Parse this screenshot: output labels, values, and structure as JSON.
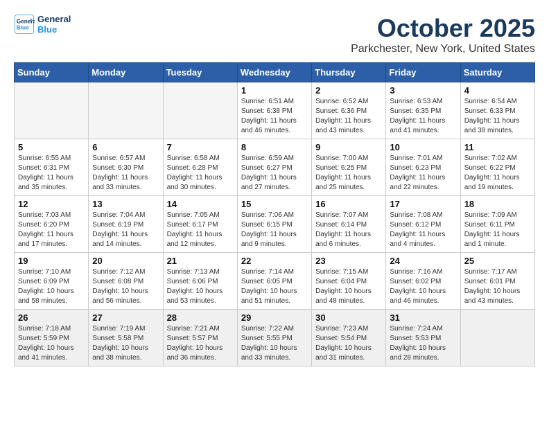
{
  "header": {
    "logo_line1": "General",
    "logo_line2": "Blue",
    "month": "October 2025",
    "location": "Parkchester, New York, United States"
  },
  "days_of_week": [
    "Sunday",
    "Monday",
    "Tuesday",
    "Wednesday",
    "Thursday",
    "Friday",
    "Saturday"
  ],
  "weeks": [
    [
      {
        "day": "",
        "info": ""
      },
      {
        "day": "",
        "info": ""
      },
      {
        "day": "",
        "info": ""
      },
      {
        "day": "1",
        "info": "Sunrise: 6:51 AM\nSunset: 6:38 PM\nDaylight: 11 hours\nand 46 minutes."
      },
      {
        "day": "2",
        "info": "Sunrise: 6:52 AM\nSunset: 6:36 PM\nDaylight: 11 hours\nand 43 minutes."
      },
      {
        "day": "3",
        "info": "Sunrise: 6:53 AM\nSunset: 6:35 PM\nDaylight: 11 hours\nand 41 minutes."
      },
      {
        "day": "4",
        "info": "Sunrise: 6:54 AM\nSunset: 6:33 PM\nDaylight: 11 hours\nand 38 minutes."
      }
    ],
    [
      {
        "day": "5",
        "info": "Sunrise: 6:55 AM\nSunset: 6:31 PM\nDaylight: 11 hours\nand 35 minutes."
      },
      {
        "day": "6",
        "info": "Sunrise: 6:57 AM\nSunset: 6:30 PM\nDaylight: 11 hours\nand 33 minutes."
      },
      {
        "day": "7",
        "info": "Sunrise: 6:58 AM\nSunset: 6:28 PM\nDaylight: 11 hours\nand 30 minutes."
      },
      {
        "day": "8",
        "info": "Sunrise: 6:59 AM\nSunset: 6:27 PM\nDaylight: 11 hours\nand 27 minutes."
      },
      {
        "day": "9",
        "info": "Sunrise: 7:00 AM\nSunset: 6:25 PM\nDaylight: 11 hours\nand 25 minutes."
      },
      {
        "day": "10",
        "info": "Sunrise: 7:01 AM\nSunset: 6:23 PM\nDaylight: 11 hours\nand 22 minutes."
      },
      {
        "day": "11",
        "info": "Sunrise: 7:02 AM\nSunset: 6:22 PM\nDaylight: 11 hours\nand 19 minutes."
      }
    ],
    [
      {
        "day": "12",
        "info": "Sunrise: 7:03 AM\nSunset: 6:20 PM\nDaylight: 11 hours\nand 17 minutes."
      },
      {
        "day": "13",
        "info": "Sunrise: 7:04 AM\nSunset: 6:19 PM\nDaylight: 11 hours\nand 14 minutes."
      },
      {
        "day": "14",
        "info": "Sunrise: 7:05 AM\nSunset: 6:17 PM\nDaylight: 11 hours\nand 12 minutes."
      },
      {
        "day": "15",
        "info": "Sunrise: 7:06 AM\nSunset: 6:15 PM\nDaylight: 11 hours\nand 9 minutes."
      },
      {
        "day": "16",
        "info": "Sunrise: 7:07 AM\nSunset: 6:14 PM\nDaylight: 11 hours\nand 6 minutes."
      },
      {
        "day": "17",
        "info": "Sunrise: 7:08 AM\nSunset: 6:12 PM\nDaylight: 11 hours\nand 4 minutes."
      },
      {
        "day": "18",
        "info": "Sunrise: 7:09 AM\nSunset: 6:11 PM\nDaylight: 11 hours\nand 1 minute."
      }
    ],
    [
      {
        "day": "19",
        "info": "Sunrise: 7:10 AM\nSunset: 6:09 PM\nDaylight: 10 hours\nand 58 minutes."
      },
      {
        "day": "20",
        "info": "Sunrise: 7:12 AM\nSunset: 6:08 PM\nDaylight: 10 hours\nand 56 minutes."
      },
      {
        "day": "21",
        "info": "Sunrise: 7:13 AM\nSunset: 6:06 PM\nDaylight: 10 hours\nand 53 minutes."
      },
      {
        "day": "22",
        "info": "Sunrise: 7:14 AM\nSunset: 6:05 PM\nDaylight: 10 hours\nand 51 minutes."
      },
      {
        "day": "23",
        "info": "Sunrise: 7:15 AM\nSunset: 6:04 PM\nDaylight: 10 hours\nand 48 minutes."
      },
      {
        "day": "24",
        "info": "Sunrise: 7:16 AM\nSunset: 6:02 PM\nDaylight: 10 hours\nand 46 minutes."
      },
      {
        "day": "25",
        "info": "Sunrise: 7:17 AM\nSunset: 6:01 PM\nDaylight: 10 hours\nand 43 minutes."
      }
    ],
    [
      {
        "day": "26",
        "info": "Sunrise: 7:18 AM\nSunset: 5:59 PM\nDaylight: 10 hours\nand 41 minutes."
      },
      {
        "day": "27",
        "info": "Sunrise: 7:19 AM\nSunset: 5:58 PM\nDaylight: 10 hours\nand 38 minutes."
      },
      {
        "day": "28",
        "info": "Sunrise: 7:21 AM\nSunset: 5:57 PM\nDaylight: 10 hours\nand 36 minutes."
      },
      {
        "day": "29",
        "info": "Sunrise: 7:22 AM\nSunset: 5:55 PM\nDaylight: 10 hours\nand 33 minutes."
      },
      {
        "day": "30",
        "info": "Sunrise: 7:23 AM\nSunset: 5:54 PM\nDaylight: 10 hours\nand 31 minutes."
      },
      {
        "day": "31",
        "info": "Sunrise: 7:24 AM\nSunset: 5:53 PM\nDaylight: 10 hours\nand 28 minutes."
      },
      {
        "day": "",
        "info": ""
      }
    ]
  ]
}
